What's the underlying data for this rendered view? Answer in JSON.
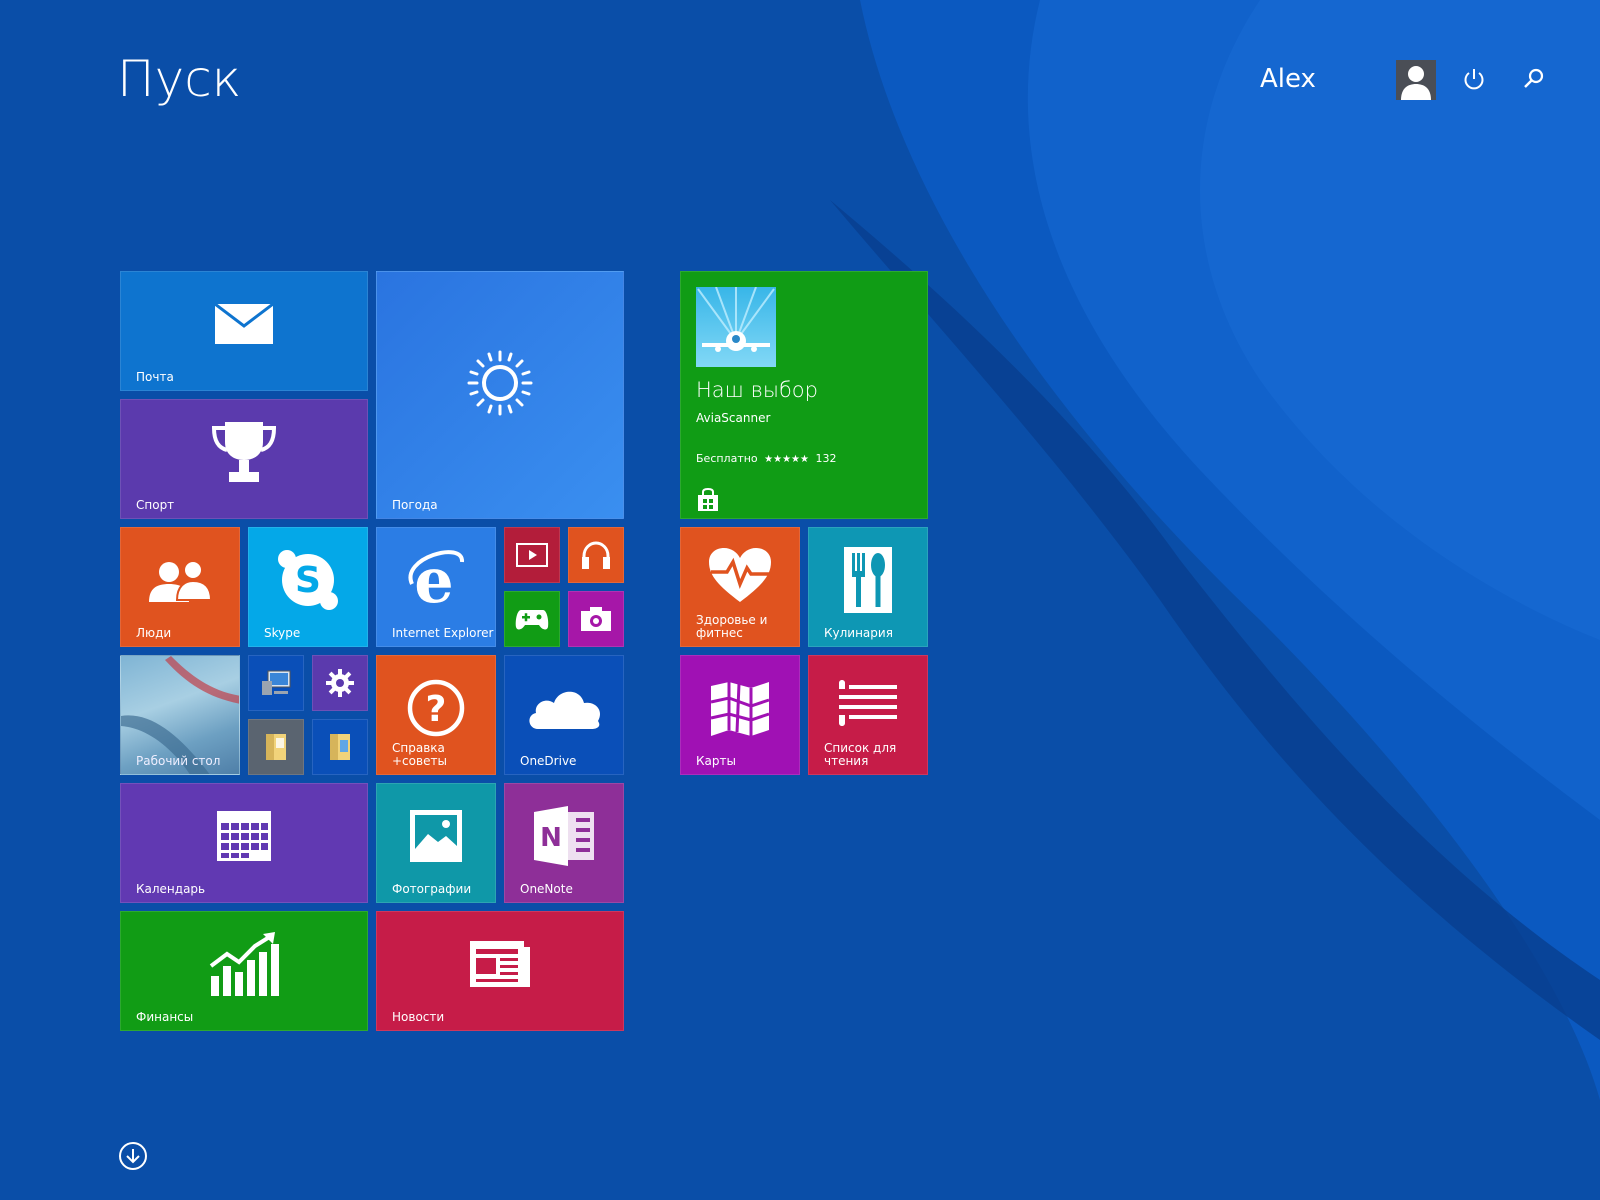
{
  "header": {
    "title": "Пуск",
    "user_name": "Alex"
  },
  "colors": {
    "background": "#0a4ea8",
    "mail": "#0e74cf",
    "sport": "#5b3aad",
    "weather": "#2f80ea",
    "people": "#e0531f",
    "skype": "#04a8e8",
    "ie": "#2b7de5",
    "video": "#b31d3a",
    "music": "#e0531f",
    "games": "#119c15",
    "camera": "#a617a8",
    "help": "#e0531f",
    "onedrive": "#0a4fb8",
    "calendar": "#6139b2",
    "photos": "#0f98a8",
    "onenote": "#8e2f98",
    "finance": "#119c15",
    "news": "#c61c48",
    "store": "#109c15",
    "health": "#e0531f",
    "food": "#0e97b4",
    "maps": "#a011b4",
    "reading": "#c61c48"
  },
  "tiles": {
    "mail": {
      "label": "Почта",
      "icon": "mail-icon"
    },
    "sport": {
      "label": "Спорт",
      "icon": "trophy-icon"
    },
    "weather": {
      "label": "Погода",
      "icon": "sun-icon"
    },
    "people": {
      "label": "Люди",
      "icon": "people-icon"
    },
    "skype": {
      "label": "Skype",
      "icon": "skype-icon"
    },
    "ie": {
      "label": "Internet Explorer",
      "icon": "internet-explorer-icon"
    },
    "video": {
      "icon": "video-icon"
    },
    "music": {
      "icon": "headphones-icon"
    },
    "games": {
      "icon": "gamepad-icon"
    },
    "camera": {
      "icon": "camera-icon"
    },
    "desktop": {
      "label": "Рабочий стол"
    },
    "this_pc": {
      "icon": "computer-icon"
    },
    "settings": {
      "icon": "gear-icon"
    },
    "files1": {
      "icon": "folder-icon"
    },
    "files2": {
      "icon": "file-explorer-icon"
    },
    "help": {
      "label1": "Справка",
      "label2": "+советы",
      "icon": "help-icon"
    },
    "onedrive": {
      "label": "OneDrive",
      "icon": "cloud-icon"
    },
    "calendar": {
      "label": "Календарь",
      "icon": "calendar-icon"
    },
    "photos": {
      "label": "Фотографии",
      "icon": "photo-icon"
    },
    "onenote": {
      "label": "OneNote",
      "icon": "onenote-icon"
    },
    "finance": {
      "label": "Финансы",
      "icon": "chart-icon"
    },
    "news": {
      "label": "Новости",
      "icon": "newspaper-icon"
    },
    "store": {
      "heading": "Наш выбор",
      "app": "AviaScanner",
      "price": "Бесплатно",
      "stars": "★★★★★",
      "rating_count": "132",
      "icon": "store-bag-icon"
    },
    "health": {
      "label1": "Здоровье и",
      "label2": "фитнес",
      "icon": "heart-icon"
    },
    "food": {
      "label": "Кулинария",
      "icon": "fork-spoon-icon"
    },
    "maps": {
      "label": "Карты",
      "icon": "map-icon"
    },
    "reading": {
      "label1": "Список для",
      "label2": "чтения",
      "icon": "reading-list-icon"
    }
  }
}
